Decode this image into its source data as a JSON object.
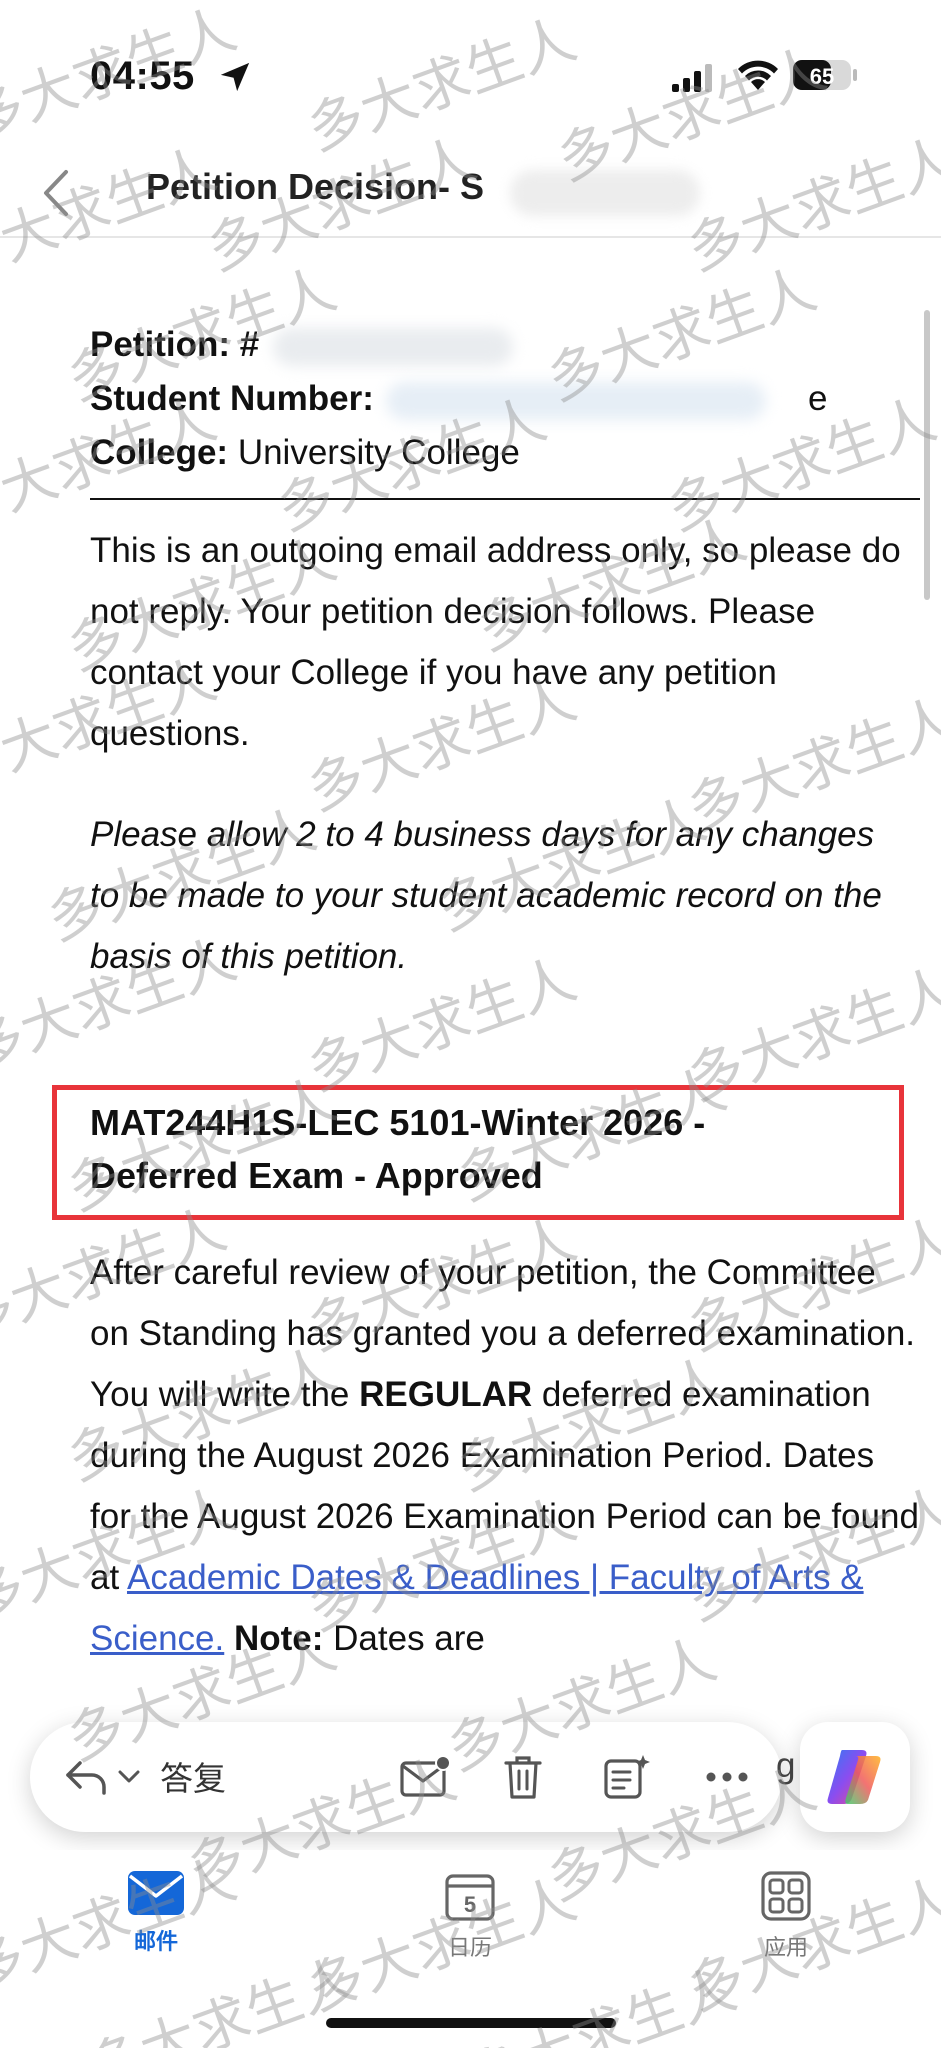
{
  "status_bar": {
    "time": "04:55",
    "battery_text": "65"
  },
  "nav": {
    "title": "Petition Decision- S"
  },
  "email": {
    "petition_label": "Petition: #",
    "student_number_label": "Student Number:",
    "student_number_tail": "e",
    "college_label": "College:",
    "college_value": "University College",
    "notice_para": "This is an outgoing email address only, so please do not reply. Your petition decision follows. Please contact your College if you have any petition questions.",
    "italic_para": "Please allow 2 to 4 business days for any changes to be made to your student academic record on the basis of this petition.",
    "course_title_line1": "MAT244H1S-LEC 5101-Winter 2026 -",
    "course_title_line2": "Deferred Exam - Approved",
    "decision_part1": "After careful review of your petition, the Committee on Standing has granted you a deferred examination. You will write the ",
    "decision_bold": "REGULAR",
    "decision_part2": " deferred examination during the August 2026 Examination Period.  Dates for the August 2026 Examination Period can be found at ",
    "link_text": "Academic Dates & Deadlines | Faculty of Arts & Science.",
    "note_label": "Note:",
    "note_text": " Dates are"
  },
  "action_bar": {
    "reply_label": "答复",
    "partial_text": "g"
  },
  "tabs": [
    {
      "label": "邮件",
      "icon": "mail-icon",
      "active": true
    },
    {
      "label": "日历",
      "icon": "calendar-icon",
      "calendar_day": "5",
      "active": false
    },
    {
      "label": "应用",
      "icon": "apps-grid-icon",
      "active": false
    }
  ],
  "watermark": {
    "text": "多大求生人"
  },
  "colors": {
    "highlight_border": "#e8343a",
    "link": "#3a5ec9",
    "active_tab": "#1467d8"
  }
}
